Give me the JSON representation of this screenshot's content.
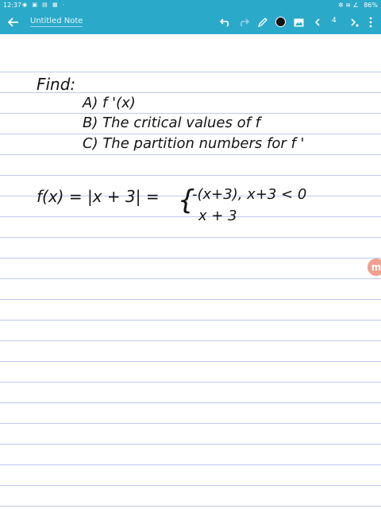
{
  "status_bar": {
    "time": "12:37",
    "left_icons": "◉ ▣ ▤ ▦ ·",
    "signal": "✲ ≋ ∠",
    "battery": "86%"
  },
  "toolbar": {
    "title": "Untitled Note",
    "page_number": "4",
    "pen_color": "#111111"
  },
  "note": {
    "find": "Find:",
    "item_a": "A)  f '(x)",
    "item_b": "B)  The critical values of  f",
    "item_c": "C)  The partition numbers for  f '",
    "equation_lhs": "f(x)  =  |x + 3|  =",
    "brace": "{",
    "case_1": "-(x+3),   x+3 < 0",
    "case_2": "x + 3"
  },
  "fab_label": "m",
  "colors": {
    "accent": "#2aa9c9",
    "ruling": "#bfc9ee",
    "fab": "#f1a08f"
  }
}
